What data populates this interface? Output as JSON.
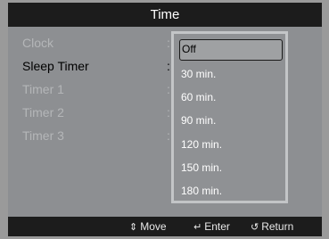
{
  "title": "Time",
  "menu": {
    "items": [
      {
        "label": "Clock",
        "state": "dim"
      },
      {
        "label": "Sleep Timer",
        "state": "active"
      },
      {
        "label": "Timer 1",
        "state": "dim"
      },
      {
        "label": "Timer 2",
        "state": "dim"
      },
      {
        "label": "Timer 3",
        "state": "dim"
      }
    ],
    "colon": ":"
  },
  "dropdown": {
    "selected": "Off",
    "options": [
      "Off",
      "30 min.",
      "60 min.",
      "90 min.",
      "120 min.",
      "150 min.",
      "180 min."
    ]
  },
  "footer": {
    "move": {
      "icon": "up-down-arrow-icon",
      "label": "Move"
    },
    "enter": {
      "icon": "enter-icon",
      "label": "Enter"
    },
    "return": {
      "icon": "return-icon",
      "label": "Return"
    }
  }
}
